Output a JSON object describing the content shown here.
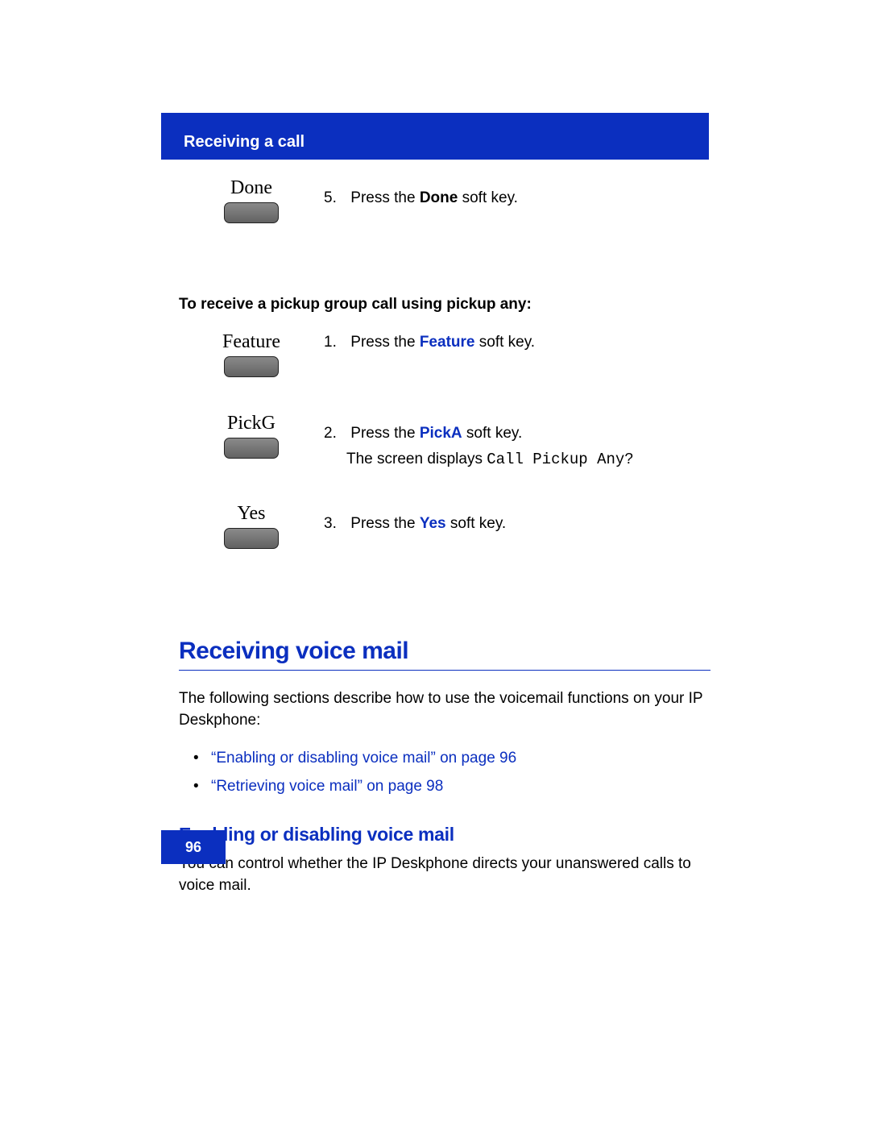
{
  "header": {
    "title": "Receiving a call"
  },
  "steps_done": {
    "key_label": "Done",
    "num": "5.",
    "text_pre": "Press the ",
    "key_name": "Done",
    "text_post": " soft key."
  },
  "subheading": "To receive a pickup group call using pickup any:",
  "step_feature": {
    "key_label": "Feature",
    "num": "1.",
    "text_pre": "Press the ",
    "key_name": "Feature",
    "text_post": " soft key."
  },
  "step_pickg": {
    "key_label": "PickG",
    "num": "2.",
    "line1_pre": "Press the ",
    "line1_key": "PickA",
    "line1_post": " soft key.",
    "line2_pre": "The screen displays ",
    "line2_mono": "Call Pickup Any?"
  },
  "step_yes": {
    "key_label": "Yes",
    "num": "3.",
    "text_pre": "Press the ",
    "key_name": "Yes",
    "text_post": " soft key."
  },
  "section": {
    "h1": "Receiving voice mail",
    "intro": "The following sections describe how to use the voicemail functions on your IP Deskphone:",
    "links": [
      "“Enabling or disabling voice mail” on page 96",
      "“Retrieving voice mail” on page 98"
    ],
    "h2": "Enabling or disabling voice mail",
    "h2_body": "You can control whether the IP Deskphone directs your unanswered calls to voice mail."
  },
  "footer": {
    "page_number": "96"
  }
}
